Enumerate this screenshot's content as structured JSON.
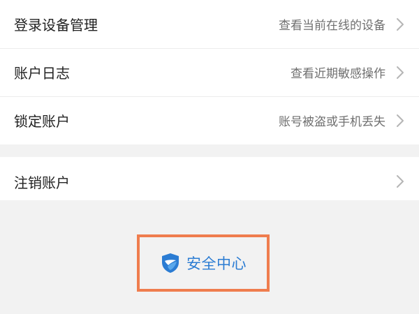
{
  "menu": {
    "items": [
      {
        "label": "登录设备管理",
        "desc": "查看当前在线的设备",
        "icon": "chevron-right-icon"
      },
      {
        "label": "账户日志",
        "desc": "查看近期敏感操作",
        "icon": "chevron-right-icon"
      },
      {
        "label": "锁定账户",
        "desc": "账号被盗或手机丢失",
        "icon": "chevron-right-icon"
      }
    ],
    "cancel_account": {
      "label": "注销账户",
      "icon": "chevron-right-icon"
    }
  },
  "security_center": {
    "label": "安全中心",
    "icon": "shield-icon",
    "accent_color": "#2b7cd3",
    "highlight_color": "#ef7d4e"
  }
}
